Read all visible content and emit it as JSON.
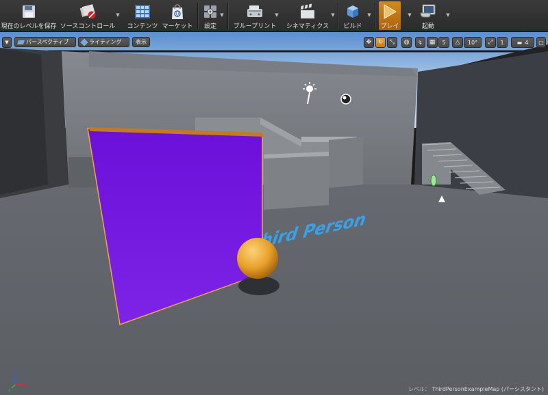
{
  "toolbar": {
    "items": [
      {
        "label": "現在のレベルを保存",
        "icon": "save-icon"
      },
      {
        "label": "ソースコントロール",
        "icon": "source-control-icon"
      },
      {
        "label": "コンテンツ",
        "icon": "content-browser-icon"
      },
      {
        "label": "マーケット",
        "icon": "marketplace-icon"
      },
      {
        "label": "設定",
        "icon": "settings-icon"
      },
      {
        "label": "ブループリント",
        "icon": "blueprint-icon"
      },
      {
        "label": "シネマティクス",
        "icon": "cinematics-icon"
      },
      {
        "label": "ビルド",
        "icon": "build-icon"
      },
      {
        "label": "プレイ",
        "icon": "play-icon"
      },
      {
        "label": "起動",
        "icon": "launch-icon"
      }
    ]
  },
  "viewport_toolbar": {
    "perspective": "パースペクティブ",
    "lighting": "ライティング",
    "show": "表示",
    "grid_snap": "5",
    "rotation_snap": "10°",
    "scale_snap": "1",
    "camera_speed": "4"
  },
  "scene": {
    "floor_text": "Third Person"
  },
  "status": {
    "level_key": "レベル：",
    "level_value": "ThirdPersonExampleMap (パーシスタント)"
  },
  "colors": {
    "accent": "#e89a2c",
    "panel": "#7a1ee0",
    "sphere": "#e8a02a",
    "floor_text": "#3aa0e8"
  }
}
